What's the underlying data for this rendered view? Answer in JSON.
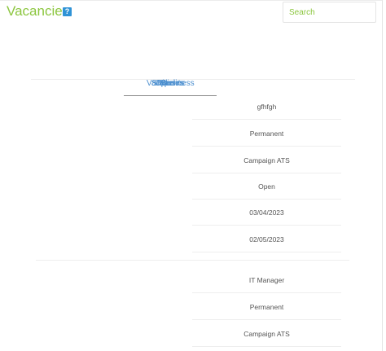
{
  "header": {
    "title": "Vacancies",
    "help_icon": "?"
  },
  "search": {
    "placeholder": "Search",
    "value": ""
  },
  "tabs": [
    {
      "label": "Vacancies"
    },
    {
      "label": "Status"
    },
    {
      "label": "Open"
    },
    {
      "label": "Pipeline"
    },
    {
      "label": "Clients"
    },
    {
      "label": "Business"
    }
  ],
  "records": [
    {
      "title": "gfhfgh",
      "type": "Permanent",
      "source": "Campaign ATS",
      "status": "Open",
      "start_date": "03/04/2023",
      "end_date": "02/05/2023"
    },
    {
      "title": "IT Manager",
      "type": "Permanent",
      "source": "Campaign ATS"
    }
  ],
  "colors": {
    "title_accent": "#8cc63f",
    "help_icon": "#2f93d6",
    "tab_text": "#4c8fcf"
  }
}
